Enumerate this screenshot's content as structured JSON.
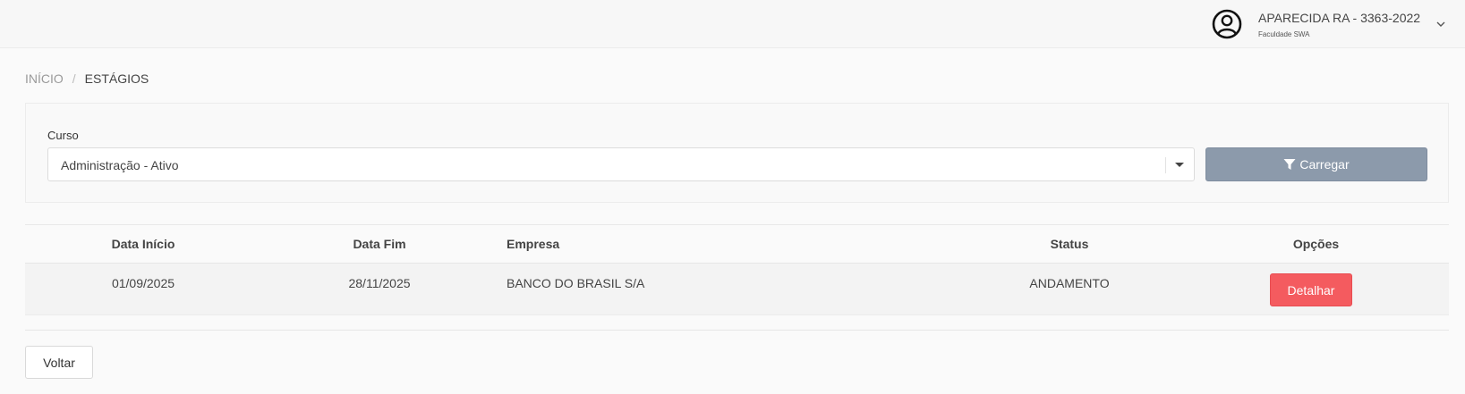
{
  "header": {
    "user_name": "APARECIDA RA - 3363-2022",
    "institution": "Faculdade SWA",
    "avatar_icon": "user-circle-icon",
    "menu_icon": "chevron-down-icon"
  },
  "breadcrumb": {
    "home": "INÍCIO",
    "separator": "/",
    "current": "ESTÁGIOS"
  },
  "filter": {
    "label": "Curso",
    "selected": "Administração - Ativo",
    "button_label": "Carregar",
    "button_icon": "filter-icon"
  },
  "table": {
    "columns": [
      "Data Início",
      "Data Fim",
      "Empresa",
      "Status",
      "Opções"
    ],
    "rows": [
      {
        "start": "01/09/2025",
        "end": "28/11/2025",
        "company": "BANCO DO BRASIL S/A",
        "status": "ANDAMENTO",
        "action": "Detalhar"
      }
    ]
  },
  "footer": {
    "back_label": "Voltar"
  },
  "colors": {
    "load_button": "#8c9aab",
    "detail_button": "#f45b5f",
    "background": "#fafafa"
  }
}
